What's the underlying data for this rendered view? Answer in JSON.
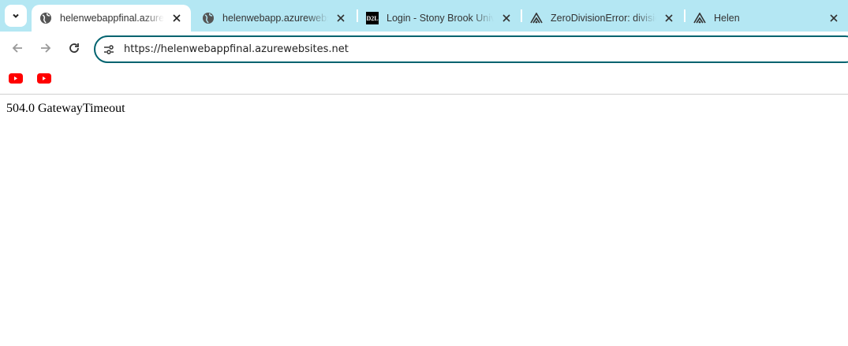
{
  "tabs": [
    {
      "title": "helenwebappfinal.azurewebsites.net",
      "display": "helenwebappfinal.azurewe",
      "icon": "globe-icon",
      "active": true
    },
    {
      "title": "helenwebapp.azurewebsites.net",
      "display": "helenwebapp.azurewebsit",
      "icon": "globe-icon"
    },
    {
      "title": "Login - Stony Brook University",
      "display": "Login - Stony Brook Unive",
      "icon": "d2l-icon",
      "icon_text": "D2L"
    },
    {
      "title": "ZeroDivisionError: division",
      "display": "ZeroDivisionError: division",
      "icon": "sentry-icon"
    },
    {
      "title": "Helen",
      "display": "Helen",
      "icon": "sentry-icon"
    }
  ],
  "address_bar": {
    "url": "https://helenwebappfinal.azurewebsites.net"
  },
  "bookmarks": [
    {
      "icon": "youtube-icon"
    },
    {
      "icon": "youtube-icon"
    }
  ],
  "page": {
    "message": "504.0 GatewayTimeout"
  },
  "colors": {
    "tabbar": "#b4e7f3",
    "omnibox_border": "#00636f",
    "youtube": "#ff0000"
  }
}
